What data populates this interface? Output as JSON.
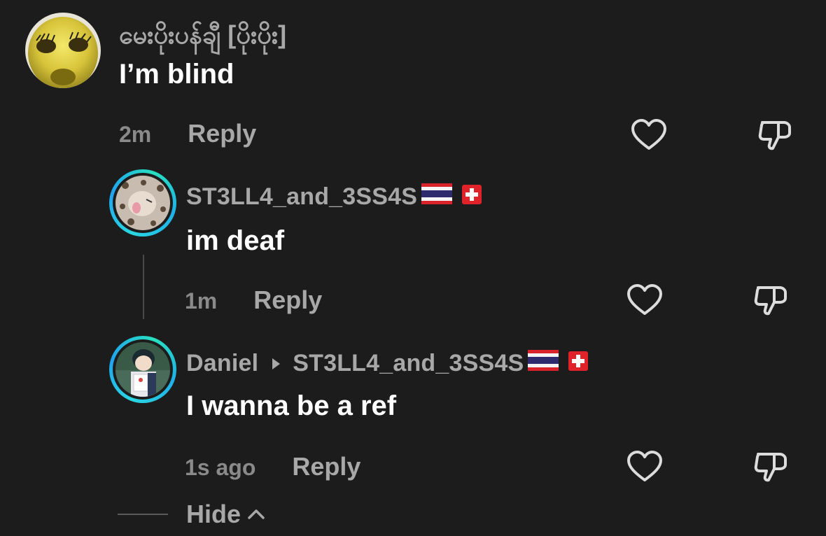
{
  "comments": [
    {
      "username": "မေးပိုးပန်ချီ [ပိုးပိုး]",
      "text": "I’m blind",
      "time": "2m",
      "reply_label": "Reply"
    },
    {
      "username": "ST3LL4_and_3SS4S",
      "text": "im deaf",
      "time": "1m",
      "reply_label": "Reply",
      "flags": [
        "thailand-flag",
        "switzerland-flag"
      ]
    },
    {
      "username": "Daniel",
      "reply_to": "ST3LL4_and_3SS4S",
      "text": "I wanna be a ref",
      "time": "1s ago",
      "reply_label": "Reply",
      "flags": [
        "thailand-flag",
        "switzerland-flag"
      ]
    }
  ],
  "hide_label": "Hide",
  "colors": {
    "background": "#1c1c1c",
    "username": "#a8a8a8",
    "body": "#ffffff",
    "meta": "#8a8a8a",
    "ring": "#2ad6e0"
  },
  "icons": [
    "heart-icon",
    "dislike-icon",
    "chevron-up-icon",
    "caret-right-icon"
  ]
}
